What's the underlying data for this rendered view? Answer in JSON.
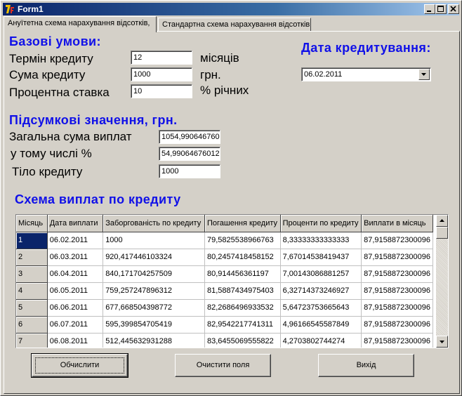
{
  "window": {
    "title": "Form1"
  },
  "tabs": [
    {
      "label": "Ануїтетна схема нарахування відсотків,"
    },
    {
      "label": "Стандартна схема нарахування відсотків"
    }
  ],
  "base_conditions": {
    "heading": "Базові умови:",
    "term_label": "Термін кредиту",
    "term_value": "12",
    "term_unit": "місяців",
    "amount_label": "Сума кредиту",
    "amount_value": "1000",
    "amount_unit": "грн.",
    "rate_label": "Процентна ставка",
    "rate_value": "10",
    "rate_unit": "% річних"
  },
  "credit_date": {
    "heading": "Дата кредитування:",
    "value": "06.02.2011"
  },
  "totals": {
    "heading": "Підсумкові значення, грн.",
    "total_label": "Загальна сума виплат",
    "total_value": "1054,990646760",
    "interest_label": "у тому числі %",
    "interest_value": "54,99064676012",
    "principal_label": "Тіло кредиту",
    "principal_value": "1000"
  },
  "schedule": {
    "heading": "Схема виплат по кредиту",
    "columns": [
      "Місяць",
      "Дата виплати",
      "Заборгованість по кредиту",
      "Погашення кредиту",
      "Проценти по кредиту",
      "Виплати в місяць"
    ],
    "rows": [
      [
        "1",
        "06.02.2011",
        "1000",
        "79,5825538966763",
        "8,33333333333333",
        "87,9158872300096"
      ],
      [
        "2",
        "06.03.2011",
        "920,417446103324",
        "80,2457418458152",
        "7,67014538419437",
        "87,9158872300096"
      ],
      [
        "3",
        "06.04.2011",
        "840,171704257509",
        "80,914456361197",
        "7,00143086881257",
        "87,9158872300096"
      ],
      [
        "4",
        "06.05.2011",
        "759,257247896312",
        "81,5887434975403",
        "6,32714373246927",
        "87,9158872300096"
      ],
      [
        "5",
        "06.06.2011",
        "677,668504398772",
        "82,2686496933532",
        "5,64723753665643",
        "87,9158872300096"
      ],
      [
        "6",
        "06.07.2011",
        "595,399854705419",
        "82,9542217741311",
        "4,96166545587849",
        "87,9158872300096"
      ],
      [
        "7",
        "06.08.2011",
        "512,445632931288",
        "83,6455069555822",
        "4,2703802744274",
        "87,9158872300096"
      ]
    ]
  },
  "buttons": {
    "calculate": "Обчислити",
    "clear": "Очистити поля",
    "exit": "Вихід"
  }
}
